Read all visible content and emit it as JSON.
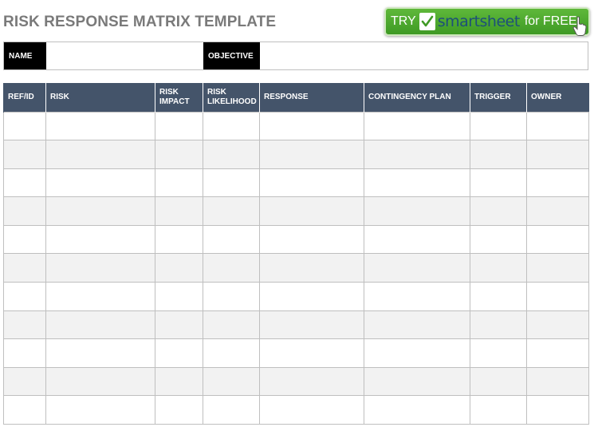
{
  "title": "RISK RESPONSE MATRIX TEMPLATE",
  "banner": {
    "try": "TRY",
    "brand": "smartsheet",
    "for_free": "for FREE",
    "icons": [
      "check-icon",
      "hand-pointer-icon"
    ],
    "colors": {
      "background": "#4caf32",
      "brand_text": "#1d4f7a"
    }
  },
  "meta": {
    "name_label": "NAME",
    "name_value": "",
    "objective_label": "OBJECTIVE",
    "objective_value": ""
  },
  "table": {
    "columns": [
      "REF/ID",
      "RISK",
      "RISK IMPACT",
      "RISK LIKELIHOOD",
      "RESPONSE",
      "CONTINGENCY PLAN",
      "TRIGGER",
      "OWNER"
    ],
    "rows": [
      [
        "",
        "",
        "",
        "",
        "",
        "",
        "",
        ""
      ],
      [
        "",
        "",
        "",
        "",
        "",
        "",
        "",
        ""
      ],
      [
        "",
        "",
        "",
        "",
        "",
        "",
        "",
        ""
      ],
      [
        "",
        "",
        "",
        "",
        "",
        "",
        "",
        ""
      ],
      [
        "",
        "",
        "",
        "",
        "",
        "",
        "",
        ""
      ],
      [
        "",
        "",
        "",
        "",
        "",
        "",
        "",
        ""
      ],
      [
        "",
        "",
        "",
        "",
        "",
        "",
        "",
        ""
      ],
      [
        "",
        "",
        "",
        "",
        "",
        "",
        "",
        ""
      ],
      [
        "",
        "",
        "",
        "",
        "",
        "",
        "",
        ""
      ],
      [
        "",
        "",
        "",
        "",
        "",
        "",
        "",
        ""
      ],
      [
        "",
        "",
        "",
        "",
        "",
        "",
        "",
        ""
      ]
    ],
    "colors": {
      "header": "#44546a",
      "stripe": "#f2f2f2"
    }
  }
}
